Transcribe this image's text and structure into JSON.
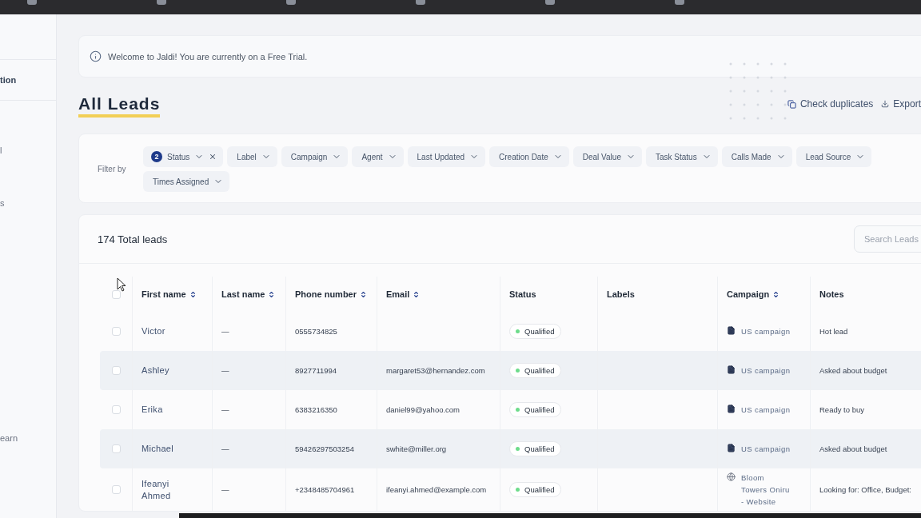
{
  "sidebar": {
    "items": [
      {
        "label": "tion",
        "selected": true
      },
      {
        "label": "l",
        "selected": false
      },
      {
        "label": "s",
        "selected": false
      },
      {
        "label": "earn",
        "selected": false
      }
    ]
  },
  "banner": {
    "text": "Welcome to Jaldi! You are currently on a Free Trial."
  },
  "page": {
    "title": "All Leads",
    "actions": [
      {
        "kind": "duplicates",
        "label": "Check duplicates"
      },
      {
        "kind": "export",
        "label": "Export"
      }
    ]
  },
  "filters": {
    "label": "Filter by",
    "chips": [
      {
        "label": "Status",
        "count": "2",
        "active": true
      },
      {
        "label": "Label",
        "active": false
      },
      {
        "label": "Campaign",
        "active": false
      },
      {
        "label": "Agent",
        "active": false
      },
      {
        "label": "Last Updated",
        "active": false
      },
      {
        "label": "Creation Date",
        "active": false
      },
      {
        "label": "Deal Value",
        "active": false
      },
      {
        "label": "Task Status",
        "active": false
      },
      {
        "label": "Calls Made",
        "active": false
      },
      {
        "label": "Lead Source",
        "active": false
      },
      {
        "label": "Times Assigned",
        "active": false
      }
    ]
  },
  "table": {
    "total": "174 Total leads",
    "search": {
      "placeholder": "Search Leads"
    },
    "all_checked": false,
    "columns": [
      {
        "label": "First name",
        "sortable": true
      },
      {
        "label": "Last name",
        "sortable": true
      },
      {
        "label": "Phone number",
        "sortable": true
      },
      {
        "label": "Email",
        "sortable": true
      },
      {
        "label": "Status",
        "sortable": false
      },
      {
        "label": "Labels",
        "sortable": false
      },
      {
        "label": "Campaign",
        "sortable": true
      },
      {
        "label": "Notes",
        "sortable": false
      }
    ],
    "rows": [
      {
        "checked": false,
        "first": "Victor",
        "last": "—",
        "phone": "0555734825",
        "email": "",
        "status": "Qualified",
        "campaign": {
          "kind": "document",
          "name": "US campaign"
        },
        "notes": "Hot lead"
      },
      {
        "checked": false,
        "first": "Ashley",
        "last": "—",
        "phone": "8927711994",
        "email": "margaret53@hernandez.com",
        "status": "Qualified",
        "campaign": {
          "kind": "document",
          "name": "US campaign"
        },
        "notes": "Asked about budget"
      },
      {
        "checked": false,
        "first": "Erika",
        "last": "—",
        "phone": "6383216350",
        "email": "daniel99@yahoo.com",
        "status": "Qualified",
        "campaign": {
          "kind": "document",
          "name": "US campaign"
        },
        "notes": "Ready to buy"
      },
      {
        "checked": false,
        "first": "Michael",
        "last": "—",
        "phone": "59426297503254",
        "email": "swhite@miller.org",
        "status": "Qualified",
        "campaign": {
          "kind": "document",
          "name": "US campaign"
        },
        "notes": "Asked about budget"
      },
      {
        "checked": false,
        "first": "Ifeanyi Ahmed",
        "last": "—",
        "phone": "+2348485704961",
        "email": "ifeanyi.ahmed@example.com",
        "status": "Qualified",
        "campaign": {
          "kind": "web",
          "name": "Bloom Towers Oniru - Website"
        },
        "notes": "Looking for: Office, Budget:"
      }
    ]
  }
}
